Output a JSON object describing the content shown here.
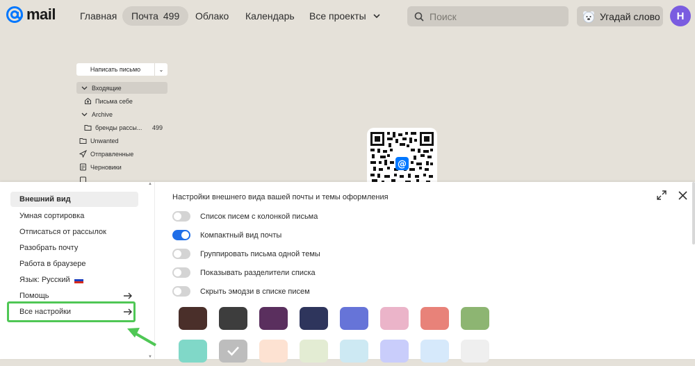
{
  "header": {
    "logo_text": "mail",
    "nav": [
      {
        "label": "Главная"
      },
      {
        "label": "Почта",
        "count": "499"
      },
      {
        "label": "Облако"
      },
      {
        "label": "Календарь"
      },
      {
        "label": "Все проекты"
      }
    ],
    "search_placeholder": "Поиск",
    "game_label": "Угадай слово",
    "avatar_letter": "Н"
  },
  "mailbox": {
    "compose_label": "Написать письмо",
    "folders": [
      {
        "label": "Входящие"
      },
      {
        "label": "Письма себе"
      },
      {
        "label": "Archive"
      },
      {
        "label": "бренды рассы...",
        "count": "499"
      },
      {
        "label": "Unwanted"
      },
      {
        "label": "Отправленные"
      },
      {
        "label": "Черновики"
      }
    ]
  },
  "settings": {
    "menu": [
      {
        "label": "Внешний вид"
      },
      {
        "label": "Умная сортировка"
      },
      {
        "label": "Отписаться от рассылок"
      },
      {
        "label": "Разобрать почту"
      },
      {
        "label": "Работа в браузере"
      },
      {
        "label": "Язык: Русский"
      },
      {
        "label": "Помощь"
      },
      {
        "label": "Все настройки"
      }
    ],
    "title": "Настройки внешнего вида вашей почты и темы оформления",
    "toggles": [
      {
        "label": "Список писем с колонкой письма",
        "on": false
      },
      {
        "label": "Компактный вид почты",
        "on": true
      },
      {
        "label": "Группировать письма одной темы",
        "on": false
      },
      {
        "label": "Показывать разделители списка",
        "on": false
      },
      {
        "label": "Скрыть эмодзи в списке писем",
        "on": false
      }
    ],
    "themes_row1": [
      "#4a2f2a",
      "#3d3d3d",
      "#5a2f5e",
      "#2e355c",
      "#6674d8",
      "#ebb4c9",
      "#e88279",
      "#8db572"
    ],
    "themes_row2": [
      "#80d8c8",
      "#bdbdbd",
      "#fde2d2",
      "#e3ecd3",
      "#cde9f3",
      "#c9cdfb",
      "#d6e9fb",
      "#efefef"
    ],
    "selected_theme": "#bdbdbd"
  },
  "colors": {
    "accent": "#1f6ee8",
    "highlight": "#4fc755"
  }
}
